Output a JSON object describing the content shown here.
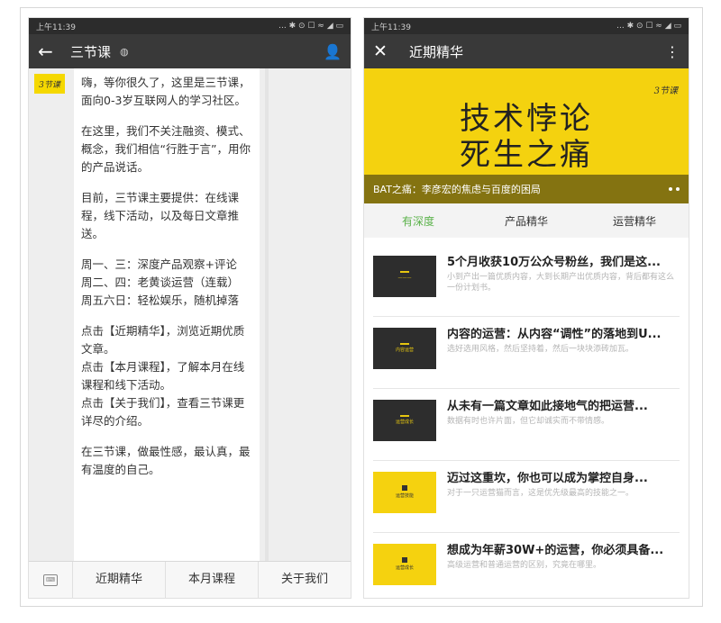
{
  "left_phone": {
    "status_time": "上午11:39",
    "status_icons": "... ✱ ⊙ ☐ ≈ ◢ ▭",
    "appbar": {
      "back_icon": "arrow-left-icon",
      "title": "三节课",
      "profile_icon": "person-icon"
    },
    "avatar_text": "3节课",
    "message_paragraphs": [
      "嗨，等你很久了，这里是三节课，面向0-3岁互联网人的学习社区。",
      "在这里，我们不关注融资、模式、概念，我们相信“行胜于言”，用你的产品说话。",
      "目前，三节课主要提供：在线课程，线下活动，以及每日文章推送。",
      "周一、三：深度产品观察+评论\n周二、四：老黄谈运营（连载）\n周五六日：轻松娱乐，随机掉落",
      "点击【近期精华】，浏览近期优质文章。\n点击【本月课程】，了解本月在线课程和线下活动。\n点击【关于我们】，查看三节课更详尽的介绍。",
      "在三节课，做最性感，最认真，最有温度的自己。"
    ],
    "bottom_menu": [
      "近期精华",
      "本月课程",
      "关于我们"
    ]
  },
  "right_phone": {
    "status_time": "上午11:39",
    "status_icons": "... ✱ ⊙ ☐ ≈ ◢ ▭",
    "appbar": {
      "close_icon": "close-icon",
      "title": "近期精华",
      "more_icon": "more-vertical-icon"
    },
    "banner": {
      "logo": "3节课",
      "headline_line1": "技术悖论",
      "headline_line2": "死生之痛",
      "caption": "BAT之痛：李彦宏的焦虑与百度的困局"
    },
    "tabs": [
      "有深度",
      "产品精华",
      "运营精华"
    ],
    "articles": [
      {
        "title": "5个月收获10万公众号粉丝，我们是这...",
        "desc": "小到产出一篇优质内容，大到长期产出优质内容，背后都有这么一份计划书。",
        "thumb": "dark",
        "thumb_text": "———"
      },
      {
        "title": "内容的运营：从内容“调性”的落地到U...",
        "desc": "选好选用风格，然后坚持着，然后一块块添砖加瓦。",
        "thumb": "dark",
        "thumb_text": "内容运营"
      },
      {
        "title": "从未有一篇文章如此接地气的把运营...",
        "desc": "数据有时也许片面，但它却诚实而不带情感。",
        "thumb": "dark",
        "thumb_text": "运营成长"
      },
      {
        "title": "迈过这重坎，你也可以成为掌控自身...",
        "desc": "对于一只运营猫而言，这是优先级最高的技能之一。",
        "thumb": "yellow",
        "thumb_text": "运营技能"
      },
      {
        "title": "想成为年薪30W+的运营，你必须具备...",
        "desc": "高级运营和普通运营的区别，究竟在哪里。",
        "thumb": "yellow",
        "thumb_text": "运营成长"
      }
    ]
  }
}
